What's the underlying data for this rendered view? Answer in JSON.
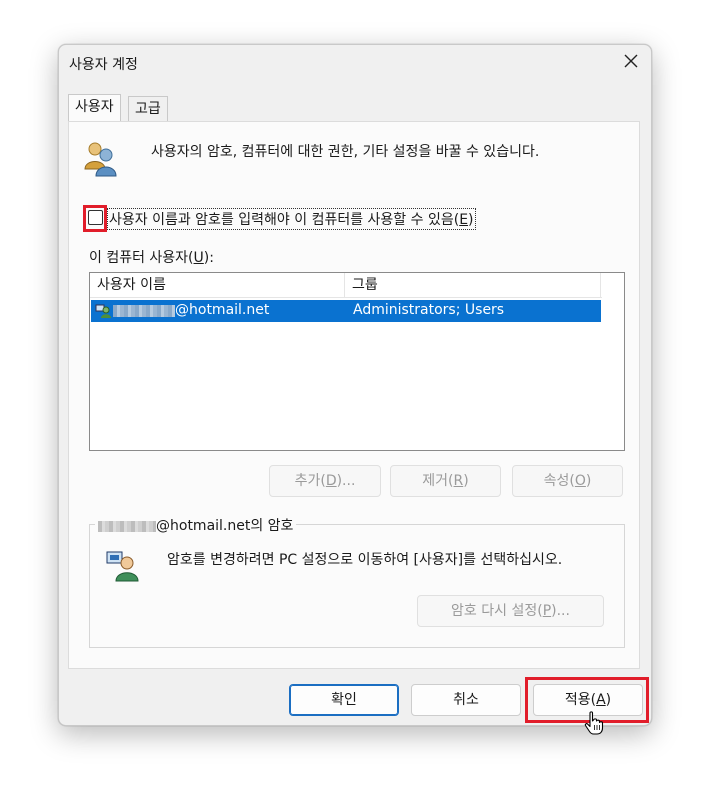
{
  "dialog": {
    "title": "사용자 계정",
    "close_icon": "close-icon"
  },
  "tabs": [
    {
      "label": "사용자",
      "active": true
    },
    {
      "label": "고급",
      "active": false
    }
  ],
  "info_text": "사용자의 암호, 컴퓨터에 대한 권한, 기타 설정을 바꿀 수 있습니다.",
  "checkbox": {
    "label_prefix": "사용자 이름과 암호를 입력해야 이 컴퓨터를 사용할 수 있음(",
    "label_key": "E",
    "label_suffix": ")",
    "checked": false
  },
  "users_section": {
    "label_prefix": "이 컴퓨터 사용자(",
    "label_key": "U",
    "label_suffix": "):",
    "columns": [
      "사용자 이름",
      "그룹"
    ],
    "rows": [
      {
        "user_visible": "@hotmail.net",
        "group": "Administrators; Users",
        "selected": true
      }
    ]
  },
  "list_buttons": [
    {
      "prefix": "추가(",
      "key": "D",
      "suffix": ")...",
      "disabled": true
    },
    {
      "prefix": "제거(",
      "key": "R",
      "suffix": ")",
      "disabled": true
    },
    {
      "prefix": "속성(",
      "key": "O",
      "suffix": ")",
      "disabled": true
    }
  ],
  "password_group": {
    "title_visible": "@hotmail.net의 암호",
    "message": "암호를 변경하려면 PC 설정으로 이동하여 [사용자]를 선택하십시오.",
    "reset_button": {
      "prefix": "암호 다시 설정(",
      "key": "P",
      "suffix": ")...",
      "disabled": true
    }
  },
  "footer_buttons": {
    "ok": "확인",
    "cancel": "취소",
    "apply_prefix": "적용(",
    "apply_key": "A",
    "apply_suffix": ")"
  },
  "colors": {
    "selection": "#0a72d0",
    "highlight": "#e11d2a",
    "accent": "#1b6ec2"
  }
}
